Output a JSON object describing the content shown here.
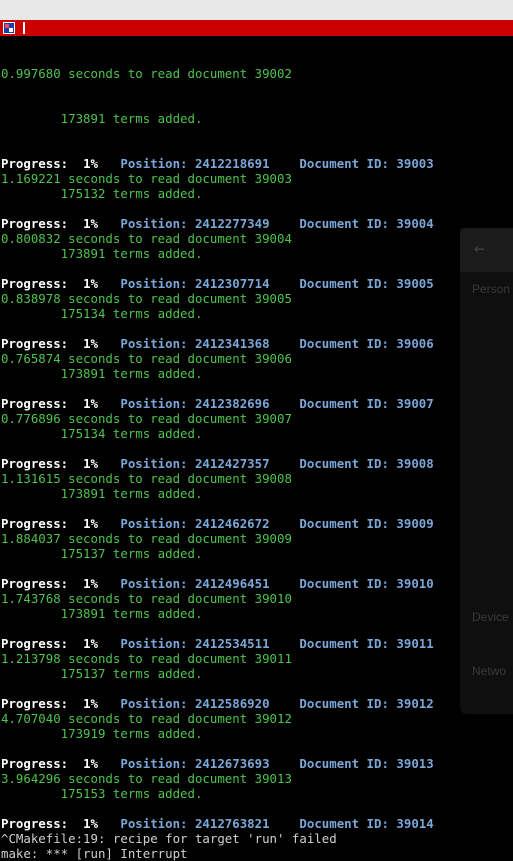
{
  "window": {
    "title_text": "",
    "icon": "terminal-app-icon"
  },
  "background_window": {
    "items": [
      "Person",
      "Device",
      "Netwo"
    ]
  },
  "terminal": {
    "first_line": "0.997680 seconds to read document 39002",
    "first_terms": "        173891 terms added.",
    "labels": {
      "progress": "Progress:",
      "position": "Position:",
      "docid": "Document ID:",
      "seconds_suffix": " seconds to read document ",
      "terms_suffix": " terms added."
    },
    "entries": [
      {
        "percent": "1%",
        "position": "2412218691",
        "doc_id": "39003",
        "seconds": "1.169221",
        "terms": "175132"
      },
      {
        "percent": "1%",
        "position": "2412277349",
        "doc_id": "39004",
        "seconds": "0.800832",
        "terms": "173891"
      },
      {
        "percent": "1%",
        "position": "2412307714",
        "doc_id": "39005",
        "seconds": "0.838978",
        "terms": "175134"
      },
      {
        "percent": "1%",
        "position": "2412341368",
        "doc_id": "39006",
        "seconds": "0.765874",
        "terms": "173891"
      },
      {
        "percent": "1%",
        "position": "2412382696",
        "doc_id": "39007",
        "seconds": "0.776896",
        "terms": "175134"
      },
      {
        "percent": "1%",
        "position": "2412427357",
        "doc_id": "39008",
        "seconds": "1.131615",
        "terms": "173891"
      },
      {
        "percent": "1%",
        "position": "2412462672",
        "doc_id": "39009",
        "seconds": "1.884037",
        "terms": "175137"
      },
      {
        "percent": "1%",
        "position": "2412496451",
        "doc_id": "39010",
        "seconds": "1.743768",
        "terms": "173891"
      },
      {
        "percent": "1%",
        "position": "2412534511",
        "doc_id": "39011",
        "seconds": "1.213798",
        "terms": "175137"
      },
      {
        "percent": "1%",
        "position": "2412586920",
        "doc_id": "39012",
        "seconds": "4.707040",
        "terms": "173919"
      },
      {
        "percent": "1%",
        "position": "2412673693",
        "doc_id": "39013",
        "seconds": "3.964296",
        "terms": "175153"
      }
    ],
    "last_entry": {
      "percent": "1%",
      "position": "2412763821",
      "doc_id": "39014"
    },
    "tail_lines": [
      "^CMakefile:19: recipe for target 'run' failed",
      "make: *** [run] Interrupt"
    ]
  },
  "colors": {
    "titlebar": "#cc0000",
    "green_text": "#4ec34e",
    "blue_text": "#7aa6d8"
  }
}
